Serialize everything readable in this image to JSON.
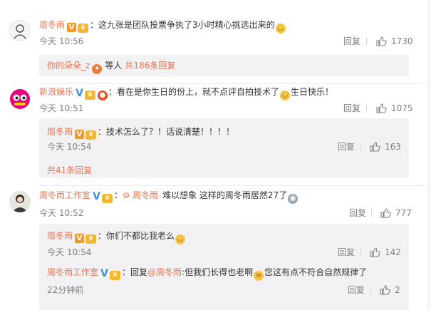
{
  "comments": [
    {
      "user": "周冬雨",
      "text": "：这九张是团队投票争执了3小时精心挑选出来的",
      "time": "今天 10:56",
      "reply_label": "回复",
      "likes": "1730",
      "sub_user": "你的朵朵_z",
      "sub_text": "等人",
      "sub_count": "共186条回复"
    },
    {
      "user": "新浪娱乐",
      "text": "：看在是你生日的份上，就不点评自拍技术了",
      "text_after_emoji": "生日快乐！",
      "time": "今天 10:51",
      "reply_label": "回复",
      "likes": "1075",
      "replies": [
        {
          "user": "周冬雨",
          "text": "：技术怎么了？！话说清楚！！！！",
          "time": "今天 10:54",
          "reply_label": "回复",
          "likes": "163"
        }
      ],
      "more_label": "共41条回复"
    },
    {
      "user": "周冬雨工作室",
      "reply_target": "周冬雨",
      "text": "难以想象 这样的周冬雨居然27了",
      "time": "今天 10:52",
      "reply_label": "回复",
      "likes": "777",
      "replies": [
        {
          "user": "周冬雨",
          "text": "：你们不都比我老么",
          "time": "今天 10:54",
          "reply_label": "回复",
          "likes": "142"
        },
        {
          "user": "周冬雨工作室",
          "text_prefix": "：回复",
          "mention": "@周冬雨",
          "text": ":但我们长得也老啊",
          "text_after_emoji": "您这有点不符合自然规律了",
          "time": "22分钟前",
          "reply_label": "回复",
          "likes": "2"
        }
      ]
    }
  ],
  "icons": {
    "v_badge": "v-verified-icon",
    "vip_badge": "vip-icon",
    "thumb": "thumb-up-icon",
    "emoji": "smile-emoji-icon",
    "fire": "fire-icon"
  },
  "colors": {
    "username": "#eb7350",
    "panel_bg": "#f2f2f5",
    "meta_text": "#808080"
  }
}
